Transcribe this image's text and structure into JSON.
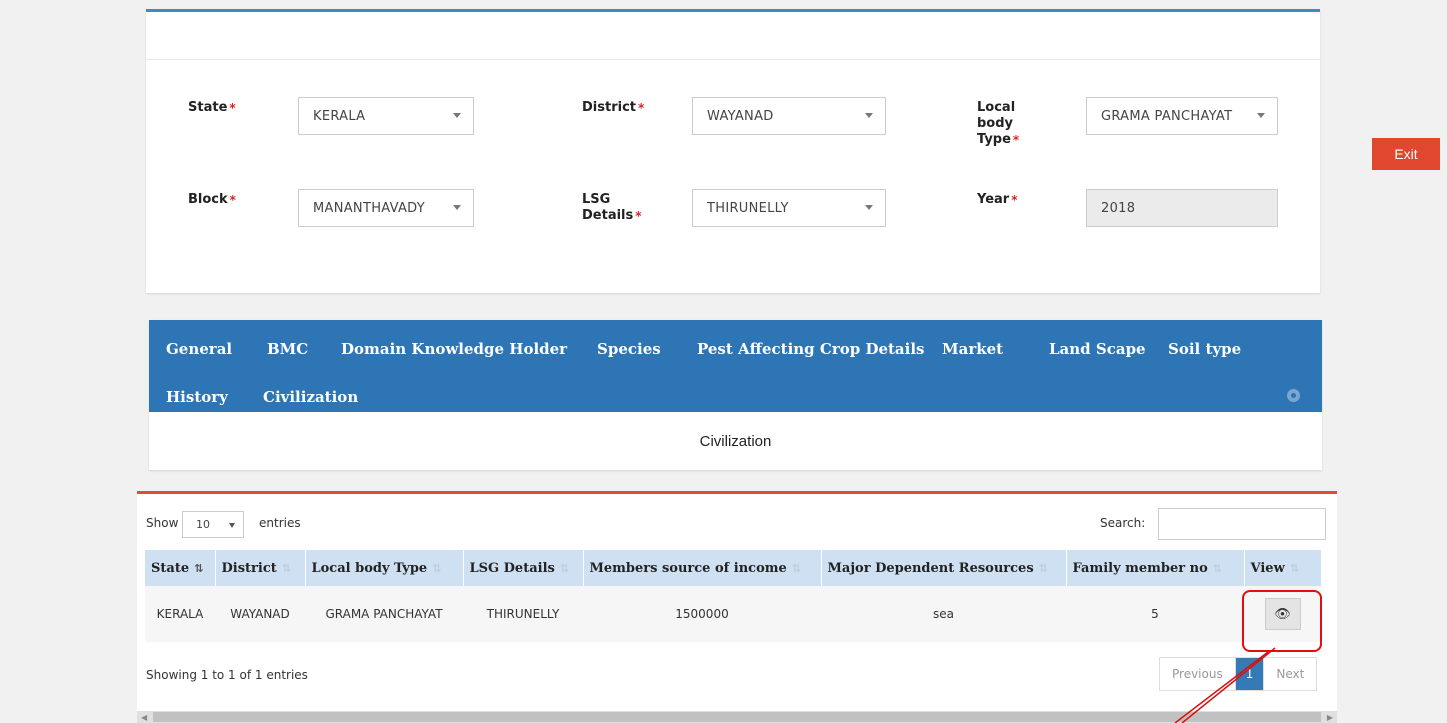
{
  "filters": {
    "state": {
      "label": "State",
      "value": "KERALA"
    },
    "district": {
      "label": "District",
      "value": "WAYANAD"
    },
    "local_body_type": {
      "label_lines": [
        "Local",
        "body",
        "Type"
      ],
      "value": "GRAMA PANCHAYAT"
    },
    "block": {
      "label": "Block",
      "value": "MANANTHAVADY"
    },
    "lsg_details": {
      "label_lines": [
        "LSG",
        "Details"
      ],
      "value": "THIRUNELLY"
    },
    "year": {
      "label": "Year",
      "value": "2018"
    },
    "required_mark": "*"
  },
  "exit_label": "Exit",
  "tabs": [
    "General",
    "BMC",
    "Domain Knowledge Holder",
    "Species",
    "Pest Affecting Crop Details",
    "Market",
    "Land Scape",
    "Soil type",
    "History",
    "Civilization"
  ],
  "active_tab_content": "Civilization",
  "table": {
    "show_label": "Show",
    "page_length": "10",
    "entries_label": "entries",
    "search_label": "Search:",
    "columns": [
      "State",
      "District",
      "Local body Type",
      "LSG Details",
      "Members source of income",
      "Major Dependent Resources",
      "Family member no",
      "View"
    ],
    "rows": [
      {
        "state": "KERALA",
        "district": "WAYANAD",
        "local_body_type": "GRAMA PANCHAYAT",
        "lsg_details": "THIRUNELLY",
        "income": "1500000",
        "resources": "sea",
        "family_members": "5"
      }
    ],
    "info": "Showing 1 to 1 of 1 entries",
    "pager": {
      "previous": "Previous",
      "current": "1",
      "next": "Next"
    }
  },
  "colors": {
    "accent_blue": "#2e75b6",
    "exit_red": "#e1462f",
    "panel_top_border": "#3c8dbc",
    "table_top_border": "#dd4b39"
  },
  "icons": {
    "view": "eye-icon",
    "settings": "gear-icon",
    "sort": "sort-icon"
  }
}
